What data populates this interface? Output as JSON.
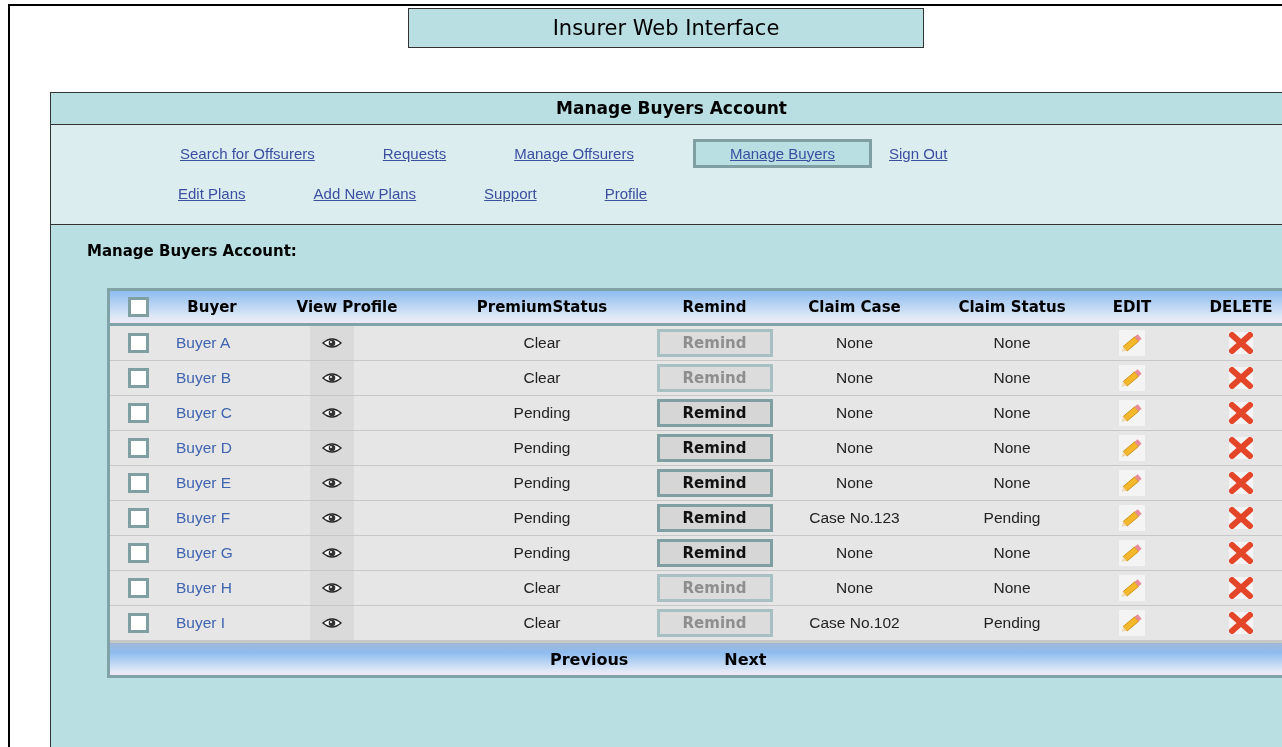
{
  "app_title": "Insurer Web Interface",
  "panel_title": "Manage Buyers Account",
  "nav_rows": [
    [
      {
        "label": "Search for Offsurers",
        "selected": false
      },
      {
        "label": "Requests",
        "selected": false
      },
      {
        "label": "Manage Offsurers",
        "selected": false
      },
      {
        "label": "Manage Buyers",
        "selected": true
      },
      {
        "label": "Sign Out",
        "selected": false
      }
    ],
    [
      {
        "label": "Edit Plans",
        "selected": false
      },
      {
        "label": "Add New Plans",
        "selected": false
      },
      {
        "label": "Support",
        "selected": false
      },
      {
        "label": "Profile",
        "selected": false
      }
    ]
  ],
  "section_title": "Manage Buyers Account:",
  "table": {
    "select_all_checked": false,
    "columns": [
      "Buyer",
      "View Profile",
      "PremiumStatus",
      "Remind",
      "Claim Case",
      "Claim Status",
      "EDIT",
      "DELETE"
    ],
    "rows": [
      {
        "checked": false,
        "buyer": "Buyer A",
        "premium_status": "Clear",
        "remind": {
          "label": "Remind",
          "disabled": true
        },
        "claim_case": "None",
        "claim_status": "None"
      },
      {
        "checked": false,
        "buyer": "Buyer B",
        "premium_status": "Clear",
        "remind": {
          "label": "Remind",
          "disabled": true
        },
        "claim_case": "None",
        "claim_status": "None"
      },
      {
        "checked": false,
        "buyer": "Buyer C",
        "premium_status": "Pending",
        "remind": {
          "label": "Remind",
          "disabled": false
        },
        "claim_case": "None",
        "claim_status": "None"
      },
      {
        "checked": false,
        "buyer": "Buyer D",
        "premium_status": "Pending",
        "remind": {
          "label": "Remind",
          "disabled": false
        },
        "claim_case": "None",
        "claim_status": "None"
      },
      {
        "checked": false,
        "buyer": "Buyer E",
        "premium_status": "Pending",
        "remind": {
          "label": "Remind",
          "disabled": false
        },
        "claim_case": "None",
        "claim_status": "None"
      },
      {
        "checked": false,
        "buyer": "Buyer F",
        "premium_status": "Pending",
        "remind": {
          "label": "Remind",
          "disabled": false
        },
        "claim_case": "Case No.123",
        "claim_status": "Pending"
      },
      {
        "checked": false,
        "buyer": "Buyer G",
        "premium_status": "Pending",
        "remind": {
          "label": "Remind",
          "disabled": false
        },
        "claim_case": "None",
        "claim_status": "None"
      },
      {
        "checked": false,
        "buyer": "Buyer H",
        "premium_status": "Clear",
        "remind": {
          "label": "Remind",
          "disabled": true
        },
        "claim_case": "None",
        "claim_status": "None"
      },
      {
        "checked": false,
        "buyer": "Buyer I",
        "premium_status": "Clear",
        "remind": {
          "label": "Remind",
          "disabled": true
        },
        "claim_case": "Case No.102",
        "claim_status": "Pending"
      }
    ],
    "pagination": [
      "Previous",
      "Next"
    ]
  }
}
